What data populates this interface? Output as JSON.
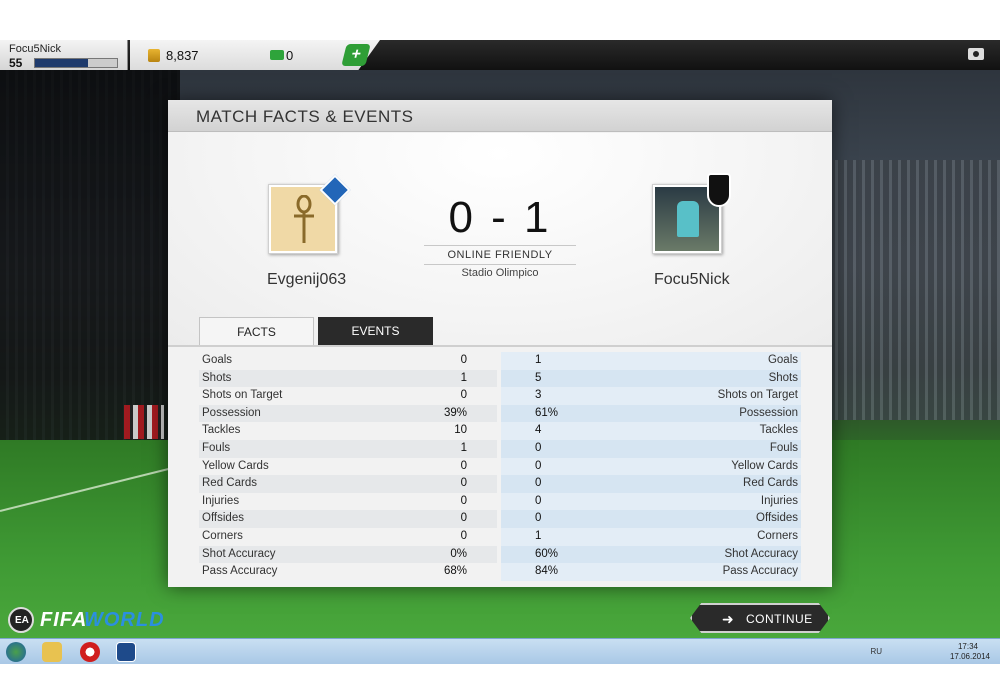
{
  "topbar": {
    "player_name": "Focu5Nick",
    "player_level": "55",
    "xp_progress": 0.65,
    "coins": "8,837",
    "points": "0",
    "add_points_label": "+"
  },
  "panel": {
    "title": "MATCH FACTS & EVENTS",
    "home_team": "Evgenij063",
    "away_team": "Focu5Nick",
    "score": "0 - 1",
    "match_type": "ONLINE FRIENDLY",
    "stadium": "Stadio Olimpico",
    "tabs": [
      {
        "label": "FACTS",
        "active": true
      },
      {
        "label": "EVENTS",
        "active": false
      }
    ],
    "stats": [
      {
        "label": "Goals",
        "home": "0",
        "away": "1"
      },
      {
        "label": "Shots",
        "home": "1",
        "away": "5"
      },
      {
        "label": "Shots on Target",
        "home": "0",
        "away": "3"
      },
      {
        "label": "Possession",
        "home": "39%",
        "away": "61%"
      },
      {
        "label": "Tackles",
        "home": "10",
        "away": "4"
      },
      {
        "label": "Fouls",
        "home": "1",
        "away": "0"
      },
      {
        "label": "Yellow Cards",
        "home": "0",
        "away": "0"
      },
      {
        "label": "Red Cards",
        "home": "0",
        "away": "0"
      },
      {
        "label": "Injuries",
        "home": "0",
        "away": "0"
      },
      {
        "label": "Offsides",
        "home": "0",
        "away": "0"
      },
      {
        "label": "Corners",
        "home": "0",
        "away": "1"
      },
      {
        "label": "Shot Accuracy",
        "home": "0%",
        "away": "60%"
      },
      {
        "label": "Pass Accuracy",
        "home": "68%",
        "away": "84%"
      }
    ]
  },
  "footer": {
    "logo_ea": "EA",
    "logo_fifa": "FIFA",
    "logo_world": "WORLD",
    "continue_label": "CONTINUE",
    "continue_icon": "arrow-right-icon"
  },
  "taskbar": {
    "language": "RU",
    "time": "17:34",
    "date": "17.06.2014"
  },
  "colors": {
    "accent_green": "#2f9e36",
    "panel_bg": "#f2f2f2",
    "dark": "#2a2a2a",
    "highlight_blue": "#2b8fe0"
  }
}
